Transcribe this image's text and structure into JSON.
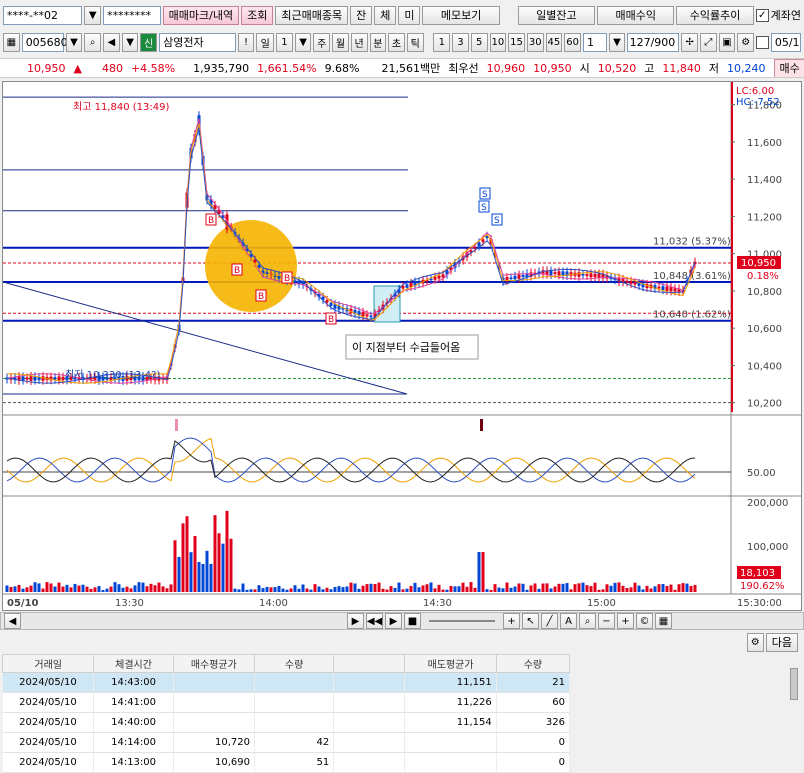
{
  "account": {
    "number": "****-**02",
    "password": "********"
  },
  "top_buttons": [
    "매매마크/내역",
    "조회",
    "최근매매종목",
    "잔",
    "체",
    "미",
    "메모보기",
    "일별잔고",
    "매매수익",
    "수익률추이"
  ],
  "checkbox_label": "계좌연",
  "stock": {
    "code": "005680",
    "market_badge": "신",
    "name": "삼영전자"
  },
  "periods": [
    "일",
    "1",
    "주",
    "월",
    "년",
    "분",
    "초",
    "틱"
  ],
  "intervals": [
    "1",
    "3",
    "5",
    "10",
    "15",
    "30",
    "45",
    "60"
  ],
  "count_value": "1",
  "page_count": "127/900",
  "date_cut": "05/1",
  "quote": {
    "price": "10,950",
    "arrow": "▲",
    "change": "480",
    "rate": "+4.58%",
    "volume": "1,935,790",
    "vol_rate": "1,661.54%",
    "turnover": "9.68%",
    "amount": "21,561백만",
    "best_label": "최우선",
    "ask": "10,960",
    "bid": "10,950",
    "open_label": "시",
    "open": "10,520",
    "high_label": "고",
    "high": "11,840",
    "low_label": "저",
    "low": "10,240",
    "buy_button": "매수"
  },
  "chart_data": {
    "type": "candlestick",
    "y_ticks": [
      "11,800",
      "11,600",
      "11,400",
      "11,200",
      "11,000",
      "10,800",
      "10,600",
      "10,400",
      "10,200"
    ],
    "x_ticks": [
      "05/10",
      "13:30",
      "14:00",
      "14:30",
      "15:00",
      "15:30:00"
    ],
    "ylim": [
      10150,
      11900
    ],
    "levels": [
      {
        "price": 11032,
        "label": "11,032 (5.37%)"
      },
      {
        "price": 10848,
        "label": "10,848 (3.61%)"
      },
      {
        "price": 10640,
        "label": "10,640 (1.62%)"
      }
    ],
    "high_note": "최고 11,840 (13:49)",
    "low_note": "최저 10,330 (13:4?)",
    "callout": "이 지점부터 수급들어옴",
    "lc": "LC:6.00",
    "hc": "HC:-7.52",
    "price_tag": "10,950",
    "rate_tag": "0.18%",
    "osc_tick": "50.00",
    "vol_ticks": [
      "200,000",
      "100,000"
    ],
    "vol_tag": "18,103",
    "vol_rate_tag": "190.62%"
  },
  "trades": {
    "headers": [
      "거래일",
      "체결시간",
      "매수평균가",
      "수량",
      "",
      "매도평균가",
      "수량"
    ],
    "rows": [
      [
        "2024/05/10",
        "14:43:00",
        "",
        "",
        "",
        "11,151",
        "21"
      ],
      [
        "2024/05/10",
        "14:41:00",
        "",
        "",
        "",
        "11,226",
        "60"
      ],
      [
        "2024/05/10",
        "14:40:00",
        "",
        "",
        "",
        "11,154",
        "326"
      ],
      [
        "2024/05/10",
        "14:14:00",
        "10,720",
        "42",
        "",
        "",
        "0"
      ],
      [
        "2024/05/10",
        "14:13:00",
        "10,690",
        "51",
        "",
        "",
        "0"
      ]
    ]
  },
  "next_button": "다음",
  "colors": {
    "up": "#e0001b",
    "down": "#0046d5",
    "highlight": "#f5b400"
  }
}
